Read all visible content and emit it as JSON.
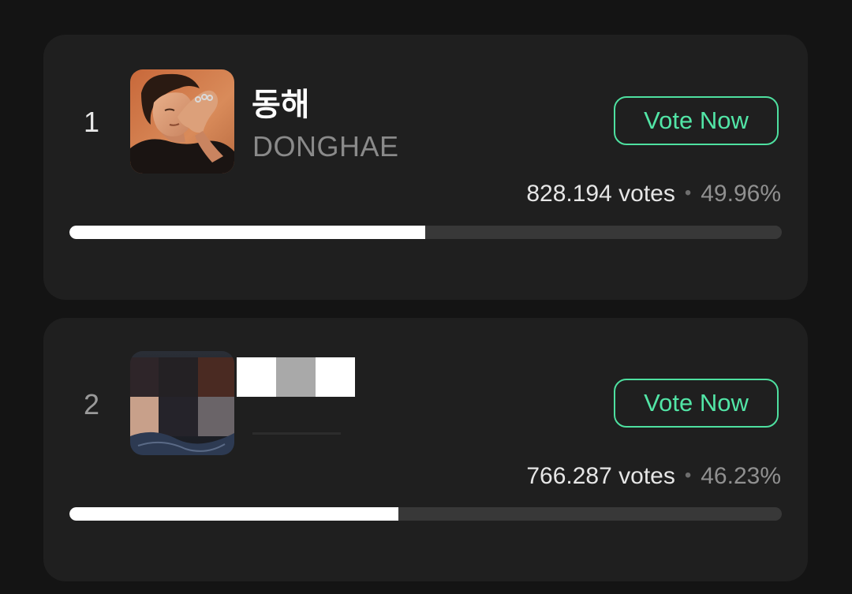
{
  "candidates": [
    {
      "rank": "1",
      "name_ko": "동해",
      "name_en": "DONGHAE",
      "vote_label": "Vote Now",
      "votes": "828.194 votes",
      "separator": "•",
      "percent": "49.96%",
      "share": 0.4996
    },
    {
      "rank": "2",
      "name_ko": "",
      "name_en": "",
      "vote_label": "Vote Now",
      "votes": "766.287 votes",
      "separator": "•",
      "percent": "46.23%",
      "share": 0.4623
    }
  ],
  "colors": {
    "accent": "#4ee0a0",
    "card": "#1f1f1f",
    "background": "#141414",
    "bar_fill": "#ffffff",
    "bar_track": "#383838"
  },
  "icons": {
    "candidate_1_photo": "artist-photo",
    "candidate_2_photo": "artist-photo-redacted"
  }
}
